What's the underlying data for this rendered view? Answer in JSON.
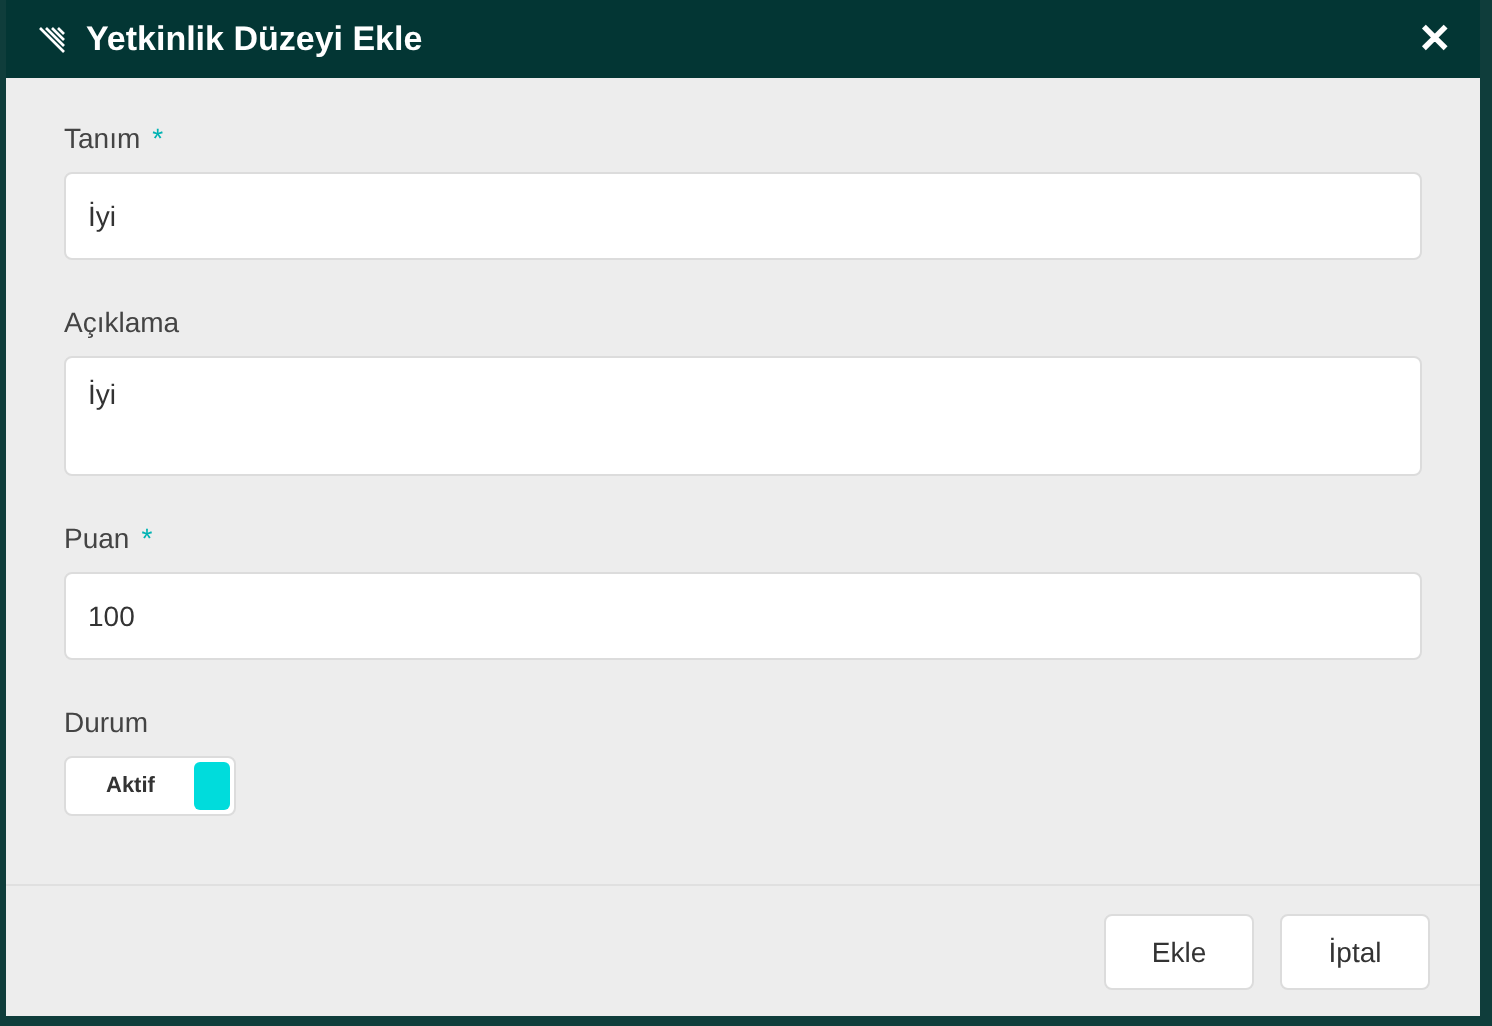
{
  "dialog": {
    "title": "Yetkinlik Düzeyi Ekle",
    "close": "✕"
  },
  "fields": [
    {
      "kind": "input",
      "label": "Tanım",
      "required_mark": "*",
      "value": "İyi"
    },
    {
      "kind": "textarea",
      "label": "Açıklama",
      "value": "İyi"
    },
    {
      "kind": "input",
      "label": "Puan",
      "required_mark": "*",
      "value": "100"
    },
    {
      "kind": "toggle",
      "label": "Durum",
      "value": "Aktif",
      "on": true
    }
  ],
  "buttons": [
    "Ekle",
    "İptal"
  ]
}
